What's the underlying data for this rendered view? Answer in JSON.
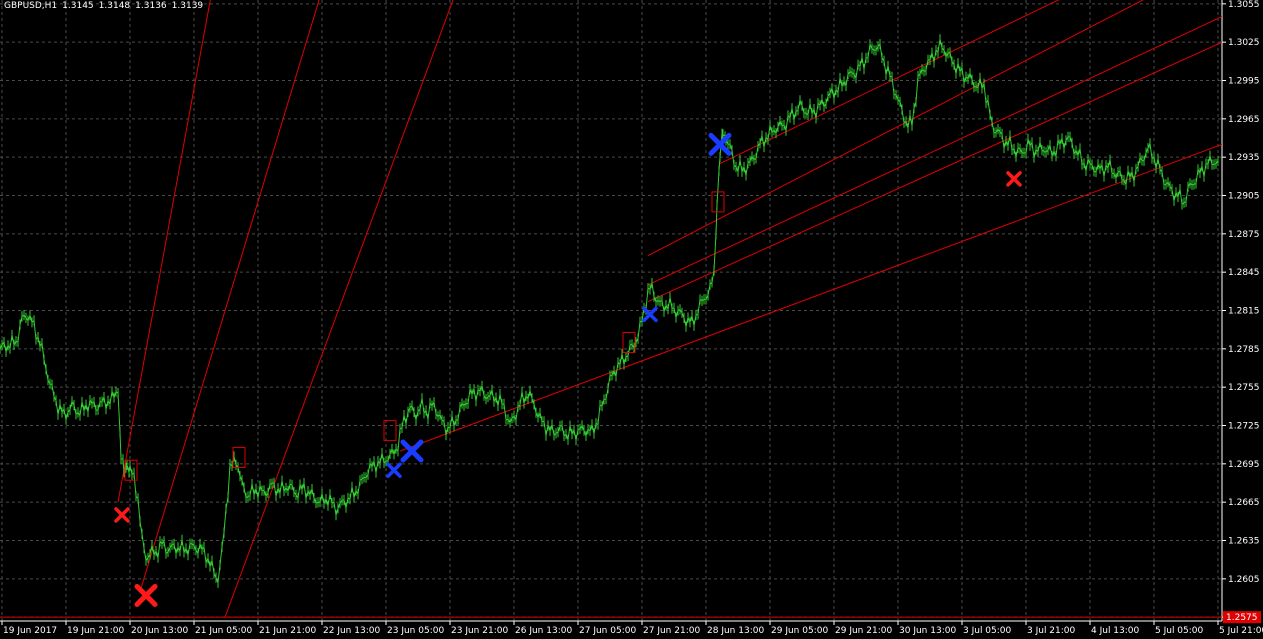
{
  "header": {
    "symbol": "GBPUSD,H1",
    "open": "1.3145",
    "high": "1.3148",
    "low": "1.3136",
    "close": "1.3139"
  },
  "chart_data": {
    "type": "line",
    "grid": true,
    "y_axis_ticks": [
      "1.3055",
      "1.3025",
      "1.2995",
      "1.2965",
      "1.2935",
      "1.2905",
      "1.2875",
      "1.2845",
      "1.2815",
      "1.2785",
      "1.2755",
      "1.2725",
      "1.2695",
      "1.2665",
      "1.2635",
      "1.2605",
      "1.2575"
    ],
    "ylim": [
      1.2572,
      1.3058
    ],
    "x_axis_ticks": [
      "19 Jun 2017",
      "19 Jun 21:00",
      "20 Jun 13:00",
      "21 Jun 05:00",
      "21 Jun 21:00",
      "22 Jun 13:00",
      "23 Jun 05:00",
      "23 Jun 21:00",
      "26 Jun 13:00",
      "27 Jun 05:00",
      "27 Jun 21:00",
      "28 Jun 13:00",
      "29 Jun 05:00",
      "29 Jun 21:00",
      "30 Jun 13:00",
      "3 Jul 05:00",
      "3 Jul 21:00",
      "4 Jul 13:00",
      "5 Jul 05:00",
      "5 Jul 21:00"
    ],
    "current_price_label": "1.2575",
    "colors": {
      "price": "#32cd32",
      "grid": "#4a4a4a",
      "trendline": "#e00000",
      "red_marker": "#ff1a1a",
      "blue_marker": "#1a3cff",
      "axis": "#ffffff"
    },
    "series": [
      {
        "values": [
          [
            0,
            1.2785
          ],
          [
            8,
            1.2788
          ],
          [
            16,
            1.279
          ],
          [
            22,
            1.2808
          ],
          [
            28,
            1.2812
          ],
          [
            34,
            1.2802
          ],
          [
            40,
            1.279
          ],
          [
            46,
            1.277
          ],
          [
            52,
            1.2752
          ],
          [
            58,
            1.274
          ],
          [
            64,
            1.2733
          ],
          [
            72,
            1.274
          ],
          [
            80,
            1.2735
          ],
          [
            88,
            1.2742
          ],
          [
            96,
            1.274
          ],
          [
            104,
            1.2743
          ],
          [
            112,
            1.2745
          ],
          [
            118,
            1.2755
          ],
          [
            121,
            1.27
          ],
          [
            124,
            1.2688
          ],
          [
            127,
            1.2695
          ],
          [
            130,
            1.269
          ],
          [
            134,
            1.2683
          ],
          [
            138,
            1.2668
          ],
          [
            142,
            1.2635
          ],
          [
            146,
            1.2622
          ],
          [
            150,
            1.2625
          ],
          [
            156,
            1.2626
          ],
          [
            162,
            1.2632
          ],
          [
            168,
            1.2628
          ],
          [
            176,
            1.263
          ],
          [
            184,
            1.2628
          ],
          [
            192,
            1.263
          ],
          [
            200,
            1.2629
          ],
          [
            206,
            1.2624
          ],
          [
            212,
            1.2613
          ],
          [
            218,
            1.2605
          ],
          [
            222,
            1.2625
          ],
          [
            226,
            1.266
          ],
          [
            230,
            1.269
          ],
          [
            236,
            1.27
          ],
          [
            242,
            1.2678
          ],
          [
            248,
            1.267
          ],
          [
            256,
            1.2675
          ],
          [
            264,
            1.2672
          ],
          [
            272,
            1.2678
          ],
          [
            280,
            1.2674
          ],
          [
            288,
            1.2678
          ],
          [
            296,
            1.2672
          ],
          [
            304,
            1.2676
          ],
          [
            312,
            1.267
          ],
          [
            320,
            1.2665
          ],
          [
            328,
            1.2668
          ],
          [
            336,
            1.266
          ],
          [
            344,
            1.2665
          ],
          [
            352,
            1.267
          ],
          [
            360,
            1.2678
          ],
          [
            368,
            1.269
          ],
          [
            376,
            1.2695
          ],
          [
            384,
            1.2698
          ],
          [
            392,
            1.2702
          ],
          [
            398,
            1.271
          ],
          [
            404,
            1.273
          ],
          [
            410,
            1.2738
          ],
          [
            416,
            1.2734
          ],
          [
            422,
            1.274
          ],
          [
            428,
            1.2735
          ],
          [
            434,
            1.2742
          ],
          [
            440,
            1.273
          ],
          [
            448,
            1.2722
          ],
          [
            456,
            1.273
          ],
          [
            464,
            1.2742
          ],
          [
            472,
            1.275
          ],
          [
            480,
            1.2752
          ],
          [
            488,
            1.2748
          ],
          [
            496,
            1.2747
          ],
          [
            504,
            1.274
          ],
          [
            510,
            1.2725
          ],
          [
            516,
            1.2735
          ],
          [
            522,
            1.2745
          ],
          [
            528,
            1.275
          ],
          [
            534,
            1.2742
          ],
          [
            540,
            1.273
          ],
          [
            546,
            1.2724
          ],
          [
            552,
            1.272
          ],
          [
            560,
            1.2722
          ],
          [
            568,
            1.2718
          ],
          [
            576,
            1.272
          ],
          [
            584,
            1.2722
          ],
          [
            592,
            1.272
          ],
          [
            598,
            1.273
          ],
          [
            604,
            1.2745
          ],
          [
            610,
            1.276
          ],
          [
            616,
            1.277
          ],
          [
            622,
            1.2775
          ],
          [
            628,
            1.2782
          ],
          [
            634,
            1.2788
          ],
          [
            640,
            1.28
          ],
          [
            644,
            1.2815
          ],
          [
            648,
            1.283
          ],
          [
            652,
            1.2832
          ],
          [
            656,
            1.2825
          ],
          [
            662,
            1.2818
          ],
          [
            668,
            1.282
          ],
          [
            674,
            1.2816
          ],
          [
            680,
            1.2813
          ],
          [
            686,
            1.2808
          ],
          [
            692,
            1.2805
          ],
          [
            698,
            1.2815
          ],
          [
            704,
            1.2825
          ],
          [
            710,
            1.283
          ],
          [
            714,
            1.2845
          ],
          [
            717,
            1.29
          ],
          [
            720,
            1.2935
          ],
          [
            723,
            1.2955
          ],
          [
            726,
            1.295
          ],
          [
            730,
            1.2942
          ],
          [
            736,
            1.2928
          ],
          [
            742,
            1.2925
          ],
          [
            748,
            1.2928
          ],
          [
            754,
            1.2935
          ],
          [
            760,
            1.2945
          ],
          [
            768,
            1.2952
          ],
          [
            776,
            1.2958
          ],
          [
            784,
            1.296
          ],
          [
            792,
            1.2968
          ],
          [
            800,
            1.2975
          ],
          [
            808,
            1.297
          ],
          [
            816,
            1.2972
          ],
          [
            824,
            1.2978
          ],
          [
            832,
            1.2985
          ],
          [
            840,
            1.299
          ],
          [
            848,
            1.2998
          ],
          [
            856,
            1.3002
          ],
          [
            864,
            1.301
          ],
          [
            872,
            1.302
          ],
          [
            878,
            1.3022
          ],
          [
            884,
            1.301
          ],
          [
            890,
            1.2998
          ],
          [
            896,
            1.2985
          ],
          [
            902,
            1.297
          ],
          [
            908,
            1.296
          ],
          [
            912,
            1.2962
          ],
          [
            918,
            1.2995
          ],
          [
            924,
            1.3005
          ],
          [
            930,
            1.301
          ],
          [
            936,
            1.3018
          ],
          [
            942,
            1.3022
          ],
          [
            948,
            1.3015
          ],
          [
            954,
            1.3008
          ],
          [
            960,
            1.3002
          ],
          [
            966,
            1.2998
          ],
          [
            972,
            1.2995
          ],
          [
            978,
            1.299
          ],
          [
            984,
            1.2992
          ],
          [
            988,
            1.2975
          ],
          [
            992,
            1.296
          ],
          [
            998,
            1.2955
          ],
          [
            1004,
            1.2948
          ],
          [
            1010,
            1.2945
          ],
          [
            1016,
            1.294
          ],
          [
            1022,
            1.2938
          ],
          [
            1028,
            1.2945
          ],
          [
            1036,
            1.294
          ],
          [
            1044,
            1.2942
          ],
          [
            1052,
            1.2938
          ],
          [
            1060,
            1.2945
          ],
          [
            1068,
            1.295
          ],
          [
            1076,
            1.294
          ],
          [
            1084,
            1.293
          ],
          [
            1092,
            1.2928
          ],
          [
            1100,
            1.2925
          ],
          [
            1108,
            1.2928
          ],
          [
            1116,
            1.2922
          ],
          [
            1124,
            1.2918
          ],
          [
            1132,
            1.292
          ],
          [
            1140,
            1.293
          ],
          [
            1148,
            1.2942
          ],
          [
            1154,
            1.2935
          ],
          [
            1160,
            1.2925
          ],
          [
            1166,
            1.2915
          ],
          [
            1172,
            1.2908
          ],
          [
            1178,
            1.2905
          ],
          [
            1184,
            1.29
          ],
          [
            1190,
            1.2912
          ],
          [
            1196,
            1.2918
          ],
          [
            1202,
            1.2925
          ],
          [
            1208,
            1.293
          ],
          [
            1214,
            1.2932
          ],
          [
            1220,
            1.293
          ]
        ]
      }
    ],
    "trendlines": [
      [
        [
          118,
          1.2665
        ],
        [
          300,
          1.344
        ]
      ],
      [
        [
          140,
          1.2595
        ],
        [
          490,
          1.35
        ]
      ],
      [
        [
          225,
          1.2575
        ],
        [
          520,
          1.32
        ]
      ],
      [
        [
          400,
          1.2705
        ],
        [
          640,
          1.2775
        ],
        [
          1222,
          1.2945
        ]
      ],
      [
        [
          648,
          1.2858
        ],
        [
          1222,
          1.309
        ]
      ],
      [
        [
          648,
          1.2835
        ],
        [
          1222,
          1.3045
        ]
      ],
      [
        [
          648,
          1.2822
        ],
        [
          1222,
          1.3025
        ]
      ],
      [
        [
          720,
          1.293
        ],
        [
          1222,
          1.312
        ]
      ]
    ],
    "x_markers": [
      {
        "x": 122,
        "y": 1.2655,
        "color": "red",
        "size": "small"
      },
      {
        "x": 146,
        "y": 1.2592,
        "color": "red",
        "size": "large"
      },
      {
        "x": 394,
        "y": 1.269,
        "color": "blue",
        "size": "small"
      },
      {
        "x": 412,
        "y": 1.2705,
        "color": "blue",
        "size": "large"
      },
      {
        "x": 650,
        "y": 1.2812,
        "color": "blue",
        "size": "small"
      },
      {
        "x": 720,
        "y": 1.2945,
        "color": "blue",
        "size": "large"
      },
      {
        "x": 1014,
        "y": 1.2918,
        "color": "red",
        "size": "small"
      }
    ],
    "box_markers": [
      {
        "x": 131,
        "y": 1.269
      },
      {
        "x": 239,
        "y": 1.27
      },
      {
        "x": 390,
        "y": 1.2721
      },
      {
        "x": 629,
        "y": 1.279
      },
      {
        "x": 718,
        "y": 1.29
      }
    ]
  }
}
